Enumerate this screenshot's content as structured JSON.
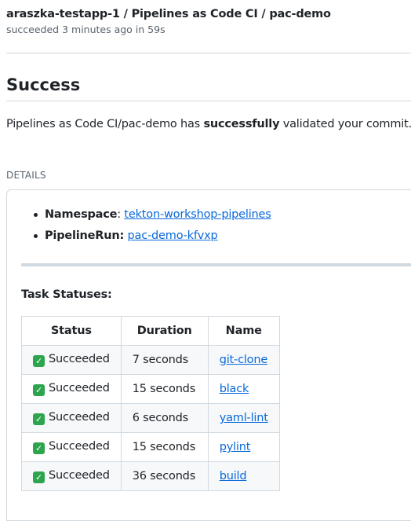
{
  "header": {
    "title": "araszka-testapp-1 / Pipelines as Code CI / pac-demo",
    "subtitle": "succeeded 3 minutes ago in 59s"
  },
  "heading": "Success",
  "summary": {
    "prefix": "Pipelines as Code CI/pac-demo has ",
    "emphasis": "successfully",
    "suffix": " validated your commit."
  },
  "details": {
    "label": "DETAILS",
    "namespace": {
      "key": "Namespace",
      "sep": ": ",
      "value": "tekton-workshop-pipelines"
    },
    "pipelinerun": {
      "key": "PipelineRun:",
      "sep": " ",
      "value": "pac-demo-kfvxp"
    },
    "task_title": "Task Statuses:",
    "table": {
      "headers": [
        "Status",
        "Duration",
        "Name"
      ],
      "rows": [
        {
          "icon": "check-mark-icon",
          "status": "Succeeded",
          "duration": "7 seconds",
          "name": "git-clone"
        },
        {
          "icon": "check-mark-icon",
          "status": "Succeeded",
          "duration": "15 seconds",
          "name": "black"
        },
        {
          "icon": "check-mark-icon",
          "status": "Succeeded",
          "duration": "6 seconds",
          "name": "yaml-lint"
        },
        {
          "icon": "check-mark-icon",
          "status": "Succeeded",
          "duration": "15 seconds",
          "name": "pylint"
        },
        {
          "icon": "check-mark-icon",
          "status": "Succeeded",
          "duration": "36 seconds",
          "name": "build"
        }
      ]
    }
  },
  "colors": {
    "link": "#0969da",
    "success": "#2da44e",
    "border": "#d1d9e0",
    "muted": "#59636e"
  }
}
